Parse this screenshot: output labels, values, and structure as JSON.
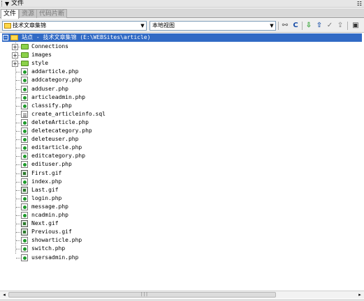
{
  "panel": {
    "title": "文件",
    "collapse_arrow": "▼",
    "options_icon": "options-menu-icon"
  },
  "tabs": [
    {
      "label": "文件",
      "active": true
    },
    {
      "label": "资源",
      "active": false
    },
    {
      "label": "代码片断",
      "active": false
    }
  ],
  "toolbar": {
    "site_select": "技术文章集锦",
    "view_select": "本地视图",
    "buttons": [
      {
        "name": "connect-icon",
        "glyph": "⚯"
      },
      {
        "name": "refresh-icon",
        "glyph": "C"
      },
      {
        "name": "get-files-icon",
        "glyph": "⇩"
      },
      {
        "name": "put-files-icon",
        "glyph": "⇧"
      },
      {
        "name": "check-out-icon",
        "glyph": "✓"
      },
      {
        "name": "check-in-icon",
        "glyph": "⇪"
      },
      {
        "name": "expand-panel-icon",
        "glyph": "▣"
      }
    ]
  },
  "tree": {
    "root_label": "站点 - 技术文章集锦 (E:\\WEBSites\\article)",
    "items": [
      {
        "name": "Connections",
        "type": "folder",
        "expandable": true
      },
      {
        "name": "images",
        "type": "folder",
        "expandable": true
      },
      {
        "name": "style",
        "type": "folder",
        "expandable": true
      },
      {
        "name": "addarticle.php",
        "type": "php"
      },
      {
        "name": "addcategory.php",
        "type": "php"
      },
      {
        "name": "adduser.php",
        "type": "php"
      },
      {
        "name": "articleadmin.php",
        "type": "php"
      },
      {
        "name": "classify.php",
        "type": "php"
      },
      {
        "name": "create_articleinfo.sql",
        "type": "xml"
      },
      {
        "name": "deleteArticle.php",
        "type": "php"
      },
      {
        "name": "deletecategory.php",
        "type": "php"
      },
      {
        "name": "deleteuser.php",
        "type": "php"
      },
      {
        "name": "editarticle.php",
        "type": "php"
      },
      {
        "name": "editcategory.php",
        "type": "php"
      },
      {
        "name": "edituser.php",
        "type": "php"
      },
      {
        "name": "First.gif",
        "type": "gif"
      },
      {
        "name": "index.php",
        "type": "php"
      },
      {
        "name": "Last.gif",
        "type": "gif"
      },
      {
        "name": "login.php",
        "type": "php"
      },
      {
        "name": "message.php",
        "type": "php"
      },
      {
        "name": "ncadmin.php",
        "type": "php"
      },
      {
        "name": "Next.gif",
        "type": "gif"
      },
      {
        "name": "Previous.gif",
        "type": "gif"
      },
      {
        "name": "showarticle.php",
        "type": "php"
      },
      {
        "name": "switch.php",
        "type": "php"
      },
      {
        "name": "usersadmin.php",
        "type": "php"
      }
    ]
  },
  "scrollbar": {
    "left_arrow": "◂",
    "right_arrow": "▸",
    "grip": "|||"
  }
}
